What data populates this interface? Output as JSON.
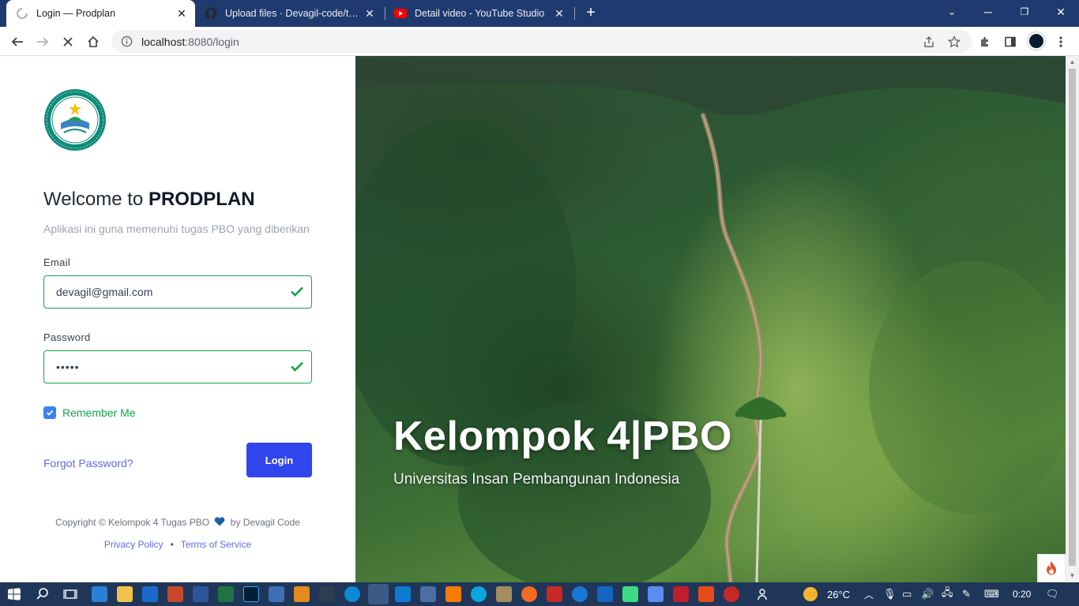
{
  "browser": {
    "tabs": [
      {
        "label": "Login — Prodplan",
        "active": true,
        "icon": "loading-spinner-icon"
      },
      {
        "label": "Upload files · Devagil-code/tugas",
        "active": false,
        "icon": "github-icon"
      },
      {
        "label": "Detail video - YouTube Studio",
        "active": false,
        "icon": "youtube-icon"
      }
    ],
    "url_host": "localhost",
    "url_path": ":8080/login"
  },
  "login": {
    "welcome_prefix": "Welcome to ",
    "app_name": "PRODPLAN",
    "subtitle": "Aplikasi ini guna memenuhi tugas PBO yang diberikan",
    "email_label": "Email",
    "email_value": "devagil@gmail.com",
    "password_label": "Password",
    "password_value": "•••••",
    "remember_label": "Remember Me",
    "remember_checked": true,
    "forgot_label": "Forgot Password?",
    "login_button": "Login",
    "copyright_prefix": "Copyright © Kelompok 4 Tugas PBO",
    "copyright_suffix": "by Devagil Code",
    "privacy_label": "Privacy Policy",
    "terms_label": "Terms of Service"
  },
  "hero": {
    "title": "Kelompok 4|PBO",
    "subtitle": "Universitas Insan Pembangunan Indonesia"
  },
  "taskbar": {
    "temperature": "26°C",
    "time": "0:20"
  },
  "colors": {
    "accent": "#3046ec",
    "valid": "#16a34a",
    "link": "#6366f1",
    "tabbar": "#1f3a6e",
    "taskbar": "#1f3658"
  }
}
